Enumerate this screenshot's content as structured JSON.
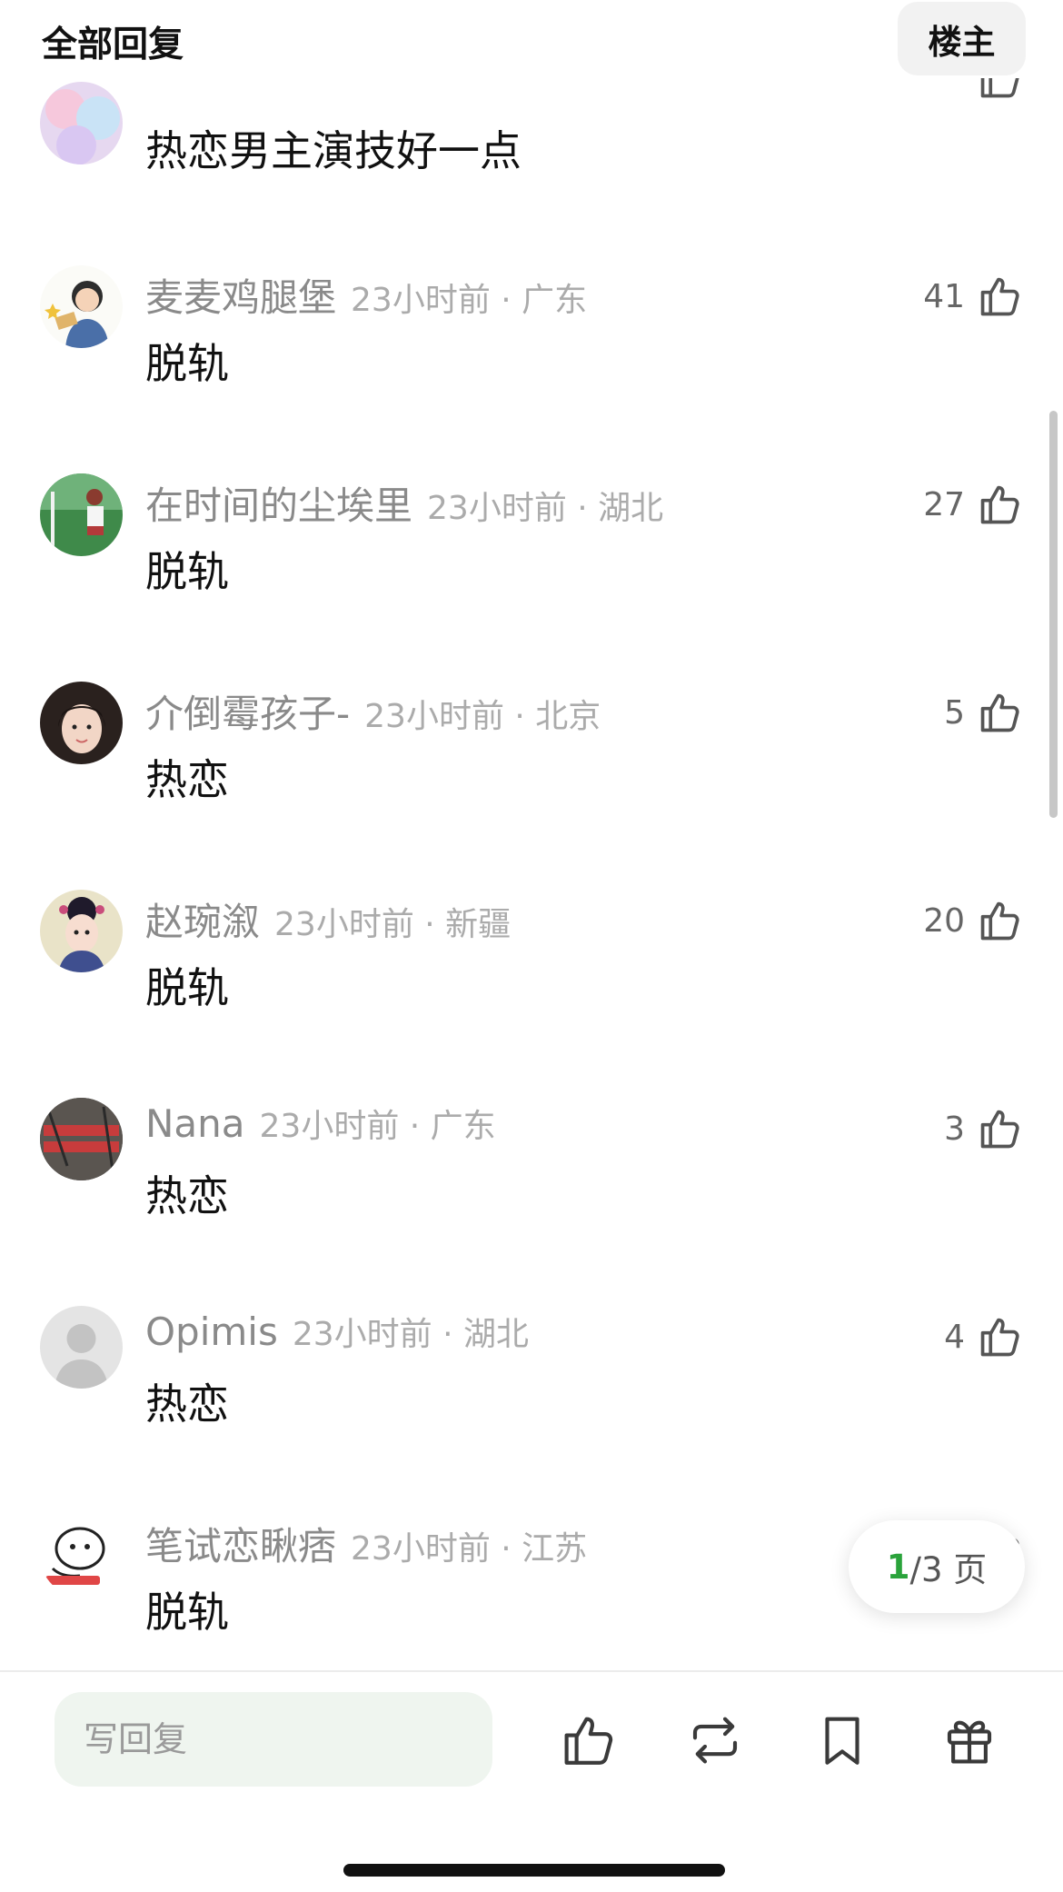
{
  "header": {
    "title": "全部回复",
    "op_button": "楼主"
  },
  "comments": [
    {
      "username": "",
      "info": "",
      "text": "热恋男主演技好一点",
      "likes": "",
      "avatar": "pastel-avatar"
    },
    {
      "username": "麦麦鸡腿堡",
      "info": "23小时前 · 广东",
      "text": "脱轨",
      "likes": "41",
      "avatar": "cartoon-girl-avatar"
    },
    {
      "username": "在时间的尘埃里",
      "info": "23小时前 · 湖北",
      "text": "脱轨",
      "likes": "27",
      "avatar": "green-field-avatar"
    },
    {
      "username": "介倒霉孩子-",
      "info": "23小时前 · 北京",
      "text": "热恋",
      "likes": "5",
      "avatar": "portrait-avatar"
    },
    {
      "username": "赵琬溆",
      "info": "23小时前 · 新疆",
      "text": "脱轨",
      "likes": "20",
      "avatar": "costume-avatar"
    },
    {
      "username": "Nana",
      "info": "23小时前 · 广东",
      "text": "热恋",
      "likes": "3",
      "avatar": "red-text-avatar"
    },
    {
      "username": "Opimis",
      "info": "23小时前 · 湖北",
      "text": "热恋",
      "likes": "4",
      "avatar": "default-avatar"
    },
    {
      "username": "笔试恋瞅痞",
      "info": "23小时前 · 江苏",
      "text": "脱轨",
      "likes": "",
      "avatar": "cartoon-sketch-avatar"
    }
  ],
  "pagination": {
    "current": "1",
    "rest": "/3 页"
  },
  "bottom_bar": {
    "reply_placeholder": "写回复",
    "icons": [
      "thumb-up-icon",
      "repost-icon",
      "bookmark-icon",
      "gift-icon"
    ]
  },
  "colors": {
    "accent_green": "#2aa33b",
    "username_gray": "#8a8a8a",
    "input_bg": "#eff5ef"
  }
}
